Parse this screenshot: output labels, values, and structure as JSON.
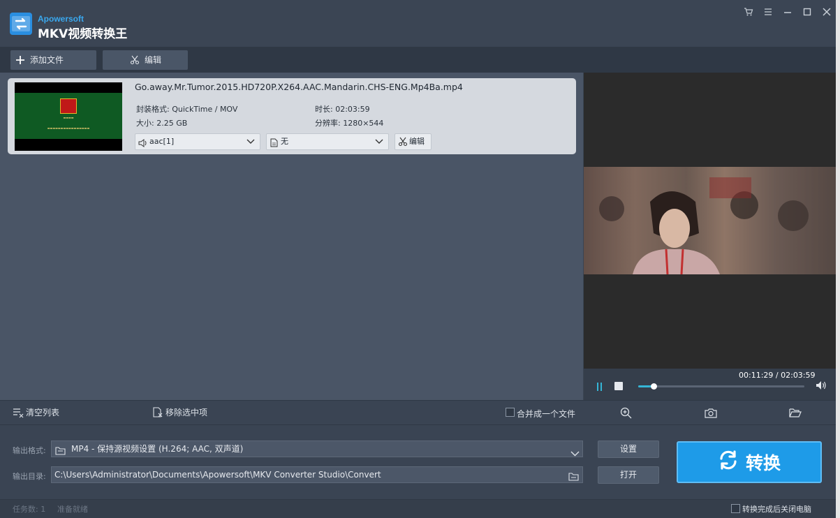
{
  "title": {
    "brand": "Apowersoft",
    "app_name": "MKV视频转换王"
  },
  "window_controls": {
    "cart": "cart-icon",
    "menu": "menu-icon",
    "minimize": "minimize-icon",
    "maximize": "maximize-icon",
    "close": "close-icon"
  },
  "toolbar": {
    "add_label": "添加文件",
    "edit_label": "编辑"
  },
  "file": {
    "name": "Go.away.Mr.Tumor.2015.HD720P.X264.AAC.Mandarin.CHS-ENG.Mp4Ba.mp4",
    "format_label": "封装格式:",
    "format_value": "QuickTime / MOV",
    "duration_label": "时长:",
    "duration_value": "02:03:59",
    "size_label": "大小:",
    "size_value": "2.25 GB",
    "resolution_label": "分辨率:",
    "resolution_value": "1280×544",
    "audio_track": "aac[1]",
    "subtitle_track": "无",
    "edit_label": "编辑"
  },
  "player": {
    "time_current": "00:11:29",
    "time_separator": " / ",
    "time_total": "02:03:59",
    "progress": 0.093
  },
  "listbar": {
    "clear_label": "清空列表",
    "remove_label": "移除选中项",
    "merge_label": "合并成一个文件"
  },
  "output": {
    "format_label": "输出格式:",
    "format_value": "MP4 - 保持源视频设置 (H.264;  AAC, 双声道)",
    "dir_label": "输出目录:",
    "dir_value": "C:\\Users\\Administrator\\Documents\\Apowersoft\\MKV Converter Studio\\Convert",
    "settings_label": "设置",
    "open_label": "打开",
    "convert_label": "转换"
  },
  "status": {
    "task_count": "任务数: 1",
    "state": "准备就绪",
    "shutdown_label": "转换完成后关闭电脑"
  },
  "colors": {
    "accent": "#1e9be8",
    "progress": "#35b6d6",
    "background": "#3a4453"
  }
}
